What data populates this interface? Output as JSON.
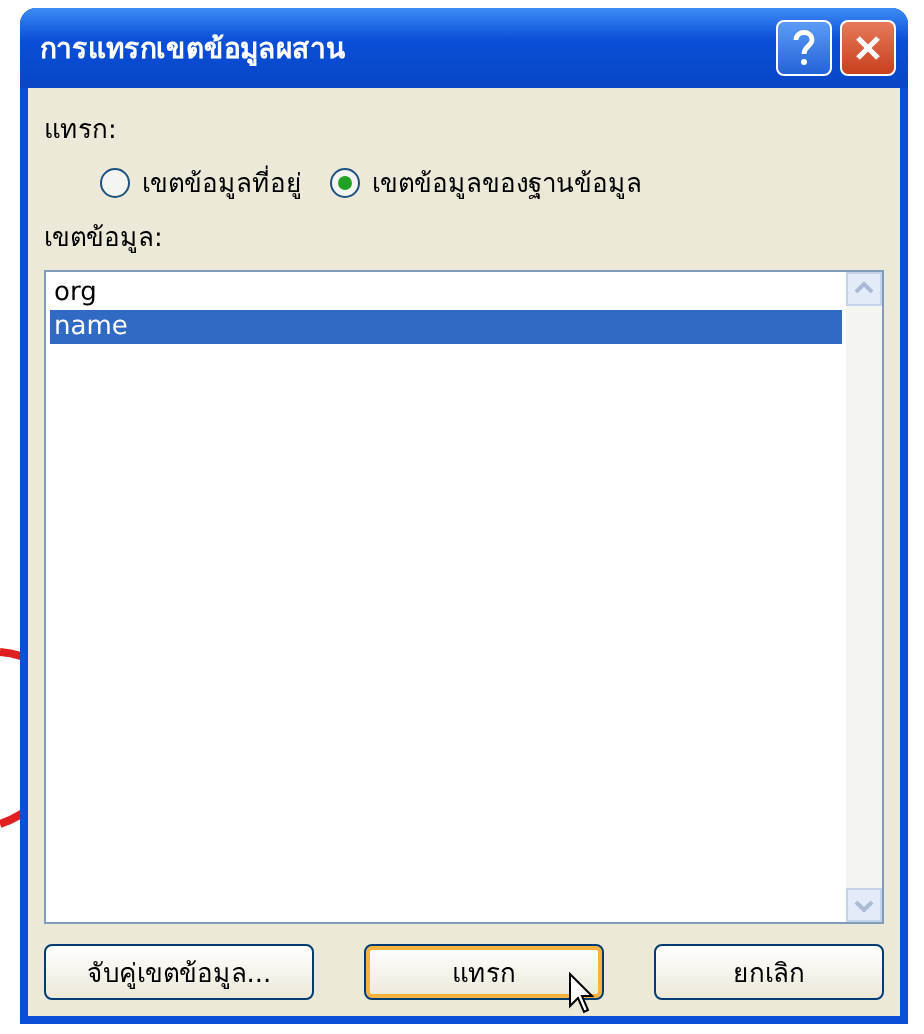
{
  "window": {
    "title": "การแทรกเขตข้อมูลผสาน"
  },
  "insert": {
    "label": "แทรก:",
    "options": [
      {
        "label": "เขตข้อมูลที่อยู่",
        "selected": false
      },
      {
        "label": "เขตข้อมูลของฐานข้อมูล",
        "selected": true
      }
    ]
  },
  "fields": {
    "label": "เขตข้อมูล:",
    "items": [
      {
        "label": "org",
        "selected": false
      },
      {
        "label": "name",
        "selected": true
      }
    ]
  },
  "buttons": [
    {
      "label": "จับคู่เขตข้อมูล...",
      "default": false
    },
    {
      "label": "แทรก",
      "default": true
    },
    {
      "label": "ยกเลิก",
      "default": false
    }
  ]
}
